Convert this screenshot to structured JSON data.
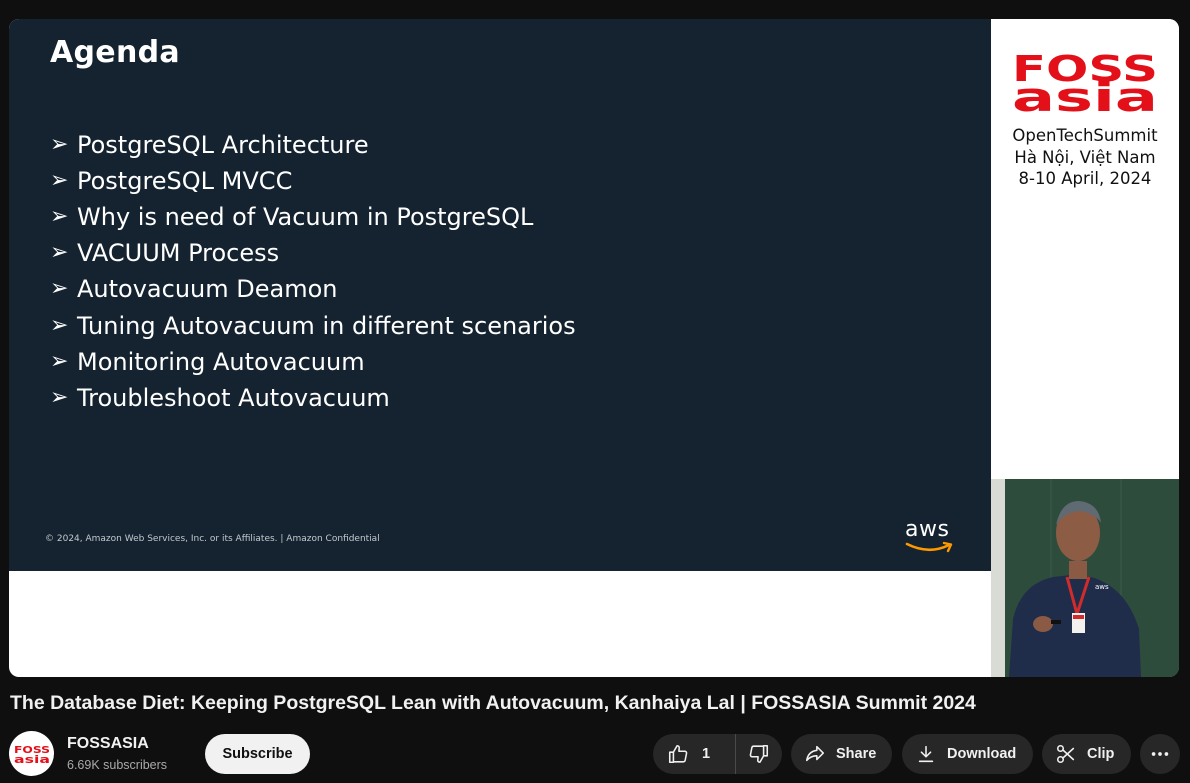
{
  "slide": {
    "title": "Agenda",
    "bullet_glyph": "➢",
    "items": [
      "PostgreSQL Architecture",
      "PostgreSQL MVCC",
      "Why is need of Vacuum in PostgreSQL",
      "VACUUM Process",
      "Autovacuum Deamon",
      "Tuning Autovacuum in different scenarios",
      "Monitoring Autovacuum",
      "Troubleshoot Autovacuum"
    ],
    "copyright": "© 2024, Amazon Web Services, Inc. or its Affiliates.  |  Amazon Confidential",
    "aws_logo_text": "aws",
    "background_color": "#14232f"
  },
  "event_panel": {
    "logo_line1": "FOSS",
    "logo_line2": "asia",
    "logo_color": "#e3101a",
    "line1": "OpenTechSummit",
    "line2": "Hà Nội, Việt Nam",
    "line3": "8-10 April, 2024"
  },
  "video": {
    "title": "The Database Diet: Keeping PostgreSQL Lean with Autovacuum, Kanhaiya Lal | FOSSASIA Summit 2024"
  },
  "channel": {
    "name": "FOSSASIA",
    "subscribers": "6.69K subscribers",
    "avatar_text": "FOSSASIA"
  },
  "actions": {
    "subscribe_label": "Subscribe",
    "like_count": "1",
    "share_label": "Share",
    "download_label": "Download",
    "clip_label": "Clip",
    "icons": [
      "thumbs-up-icon",
      "thumbs-down-icon",
      "share-icon",
      "download-icon",
      "scissors-icon",
      "more-icon"
    ]
  }
}
